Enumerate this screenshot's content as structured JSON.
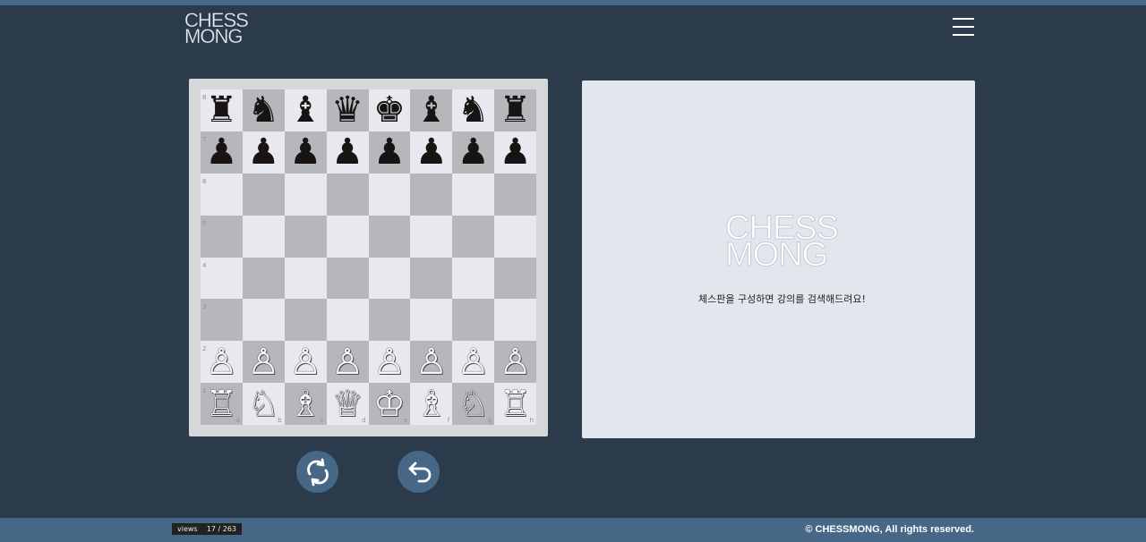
{
  "header": {
    "logo_line1": "CHESS",
    "logo_line2": "MONG",
    "menu_icon": "hamburger-menu-icon"
  },
  "board": {
    "ranks": [
      "8",
      "7",
      "6",
      "5",
      "4",
      "3",
      "2",
      "1"
    ],
    "files": [
      "a",
      "b",
      "c",
      "d",
      "e",
      "f",
      "g",
      "h"
    ],
    "position": [
      [
        "♜",
        "♞",
        "♝",
        "♛",
        "♚",
        "♝",
        "♞",
        "♜"
      ],
      [
        "♟",
        "♟",
        "♟",
        "♟",
        "♟",
        "♟",
        "♟",
        "♟"
      ],
      [
        "",
        "",
        "",
        "",
        "",
        "",
        "",
        ""
      ],
      [
        "",
        "",
        "",
        "",
        "",
        "",
        "",
        ""
      ],
      [
        "",
        "",
        "",
        "",
        "",
        "",
        "",
        ""
      ],
      [
        "",
        "",
        "",
        "",
        "",
        "",
        "",
        ""
      ],
      [
        "♙",
        "♙",
        "♙",
        "♙",
        "♙",
        "♙",
        "♙",
        "♙"
      ],
      [
        "♖",
        "♘",
        "♗",
        "♕",
        "♔",
        "♗",
        "♘",
        "♖"
      ]
    ],
    "light_color": "#e7e9ee",
    "dark_color": "#b5b7bb"
  },
  "controls": {
    "rotate_icon": "rotate-board-icon",
    "undo_icon": "undo-arrow-icon",
    "accent": "#466786"
  },
  "panel": {
    "logo_line1": "CHESS",
    "logo_line2": "MONG",
    "message": "체스판을 구성하면 강의를 검색해드려요!"
  },
  "footer": {
    "views": "views    17 / 263",
    "copyright": "© CHESSMONG, All rights reserved."
  },
  "colors": {
    "background": "#2c3b4b",
    "bar": "#466786"
  }
}
